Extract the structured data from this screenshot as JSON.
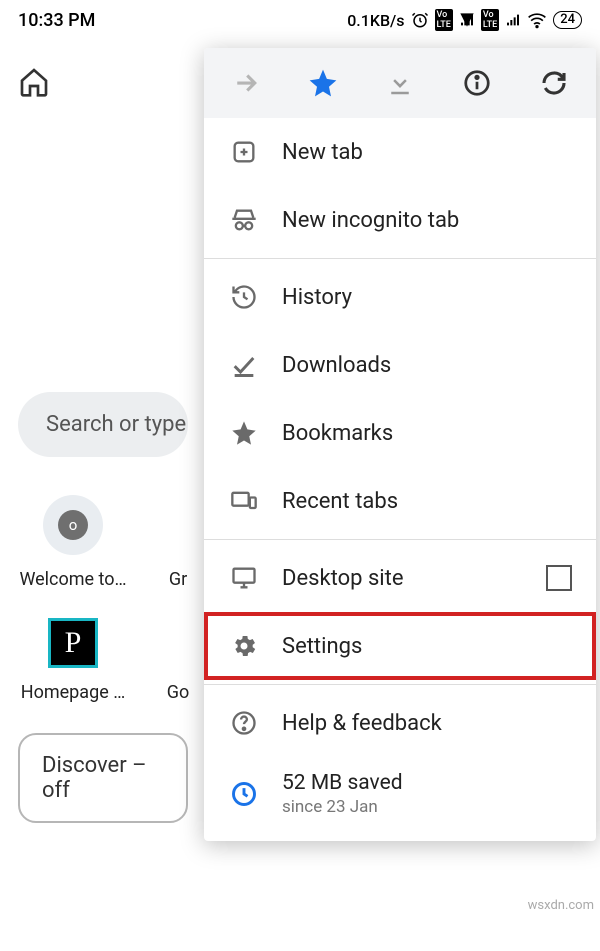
{
  "statusbar": {
    "time": "10:33 PM",
    "net_rate": "0.1KB/s",
    "battery": "24"
  },
  "page": {
    "search_placeholder": "Search or type",
    "shortcuts": [
      {
        "label": "Welcome to…",
        "badge": "o"
      },
      {
        "label": "Gr"
      },
      {
        "label": "Homepage …"
      },
      {
        "label": "Go"
      }
    ],
    "discover": "Discover – off"
  },
  "menu": {
    "items": {
      "new_tab": "New tab",
      "incognito": "New incognito tab",
      "history": "History",
      "downloads": "Downloads",
      "bookmarks": "Bookmarks",
      "recent_tabs": "Recent tabs",
      "desktop_site": "Desktop site",
      "settings": "Settings",
      "help": "Help & feedback"
    },
    "data_saved": {
      "line1": "52 MB saved",
      "line2": "since 23 Jan"
    }
  },
  "watermark": "wsxdn.com"
}
